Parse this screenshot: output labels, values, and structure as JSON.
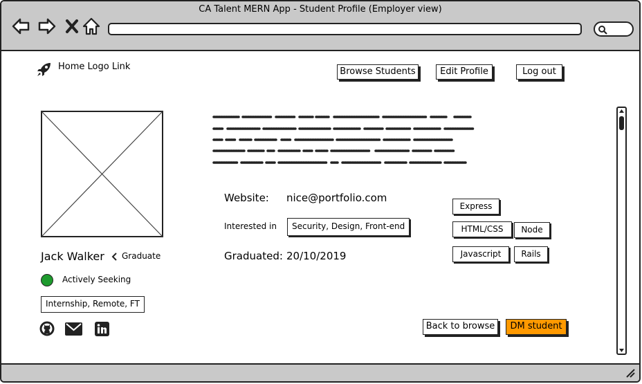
{
  "window": {
    "title": "CA Talent MERN App - Student Profile (Employer view)"
  },
  "icons": [
    "back-icon",
    "forward-icon",
    "close-icon",
    "home-icon",
    "search-icon",
    "rocket-icon",
    "github-icon",
    "email-icon",
    "linkedin-icon",
    "resize-grip-icon"
  ],
  "header": {
    "logo_link": "Home Logo Link",
    "nav": [
      "Browse Students",
      "Edit Profile",
      "Log out"
    ]
  },
  "profile": {
    "name": "Jack Walker",
    "level": "Graduate",
    "status": "Actively Seeking",
    "status_color": "#1e9b2e",
    "work_types": "Internship, Remote, FT"
  },
  "details": {
    "website_label": "Website:",
    "website_value": "nice@portfolio.com",
    "interested_label": "Interested in",
    "interested_value": "Security, Design, Front-end",
    "graduated_label": "Graduated:",
    "graduated_value": "20/10/2019"
  },
  "skills": [
    "Express",
    "HTML/CSS",
    "Node",
    "Javascript",
    "Rails"
  ],
  "actions": {
    "back": "Back to browse",
    "dm": "DM student",
    "dm_color": "#ff9900"
  }
}
